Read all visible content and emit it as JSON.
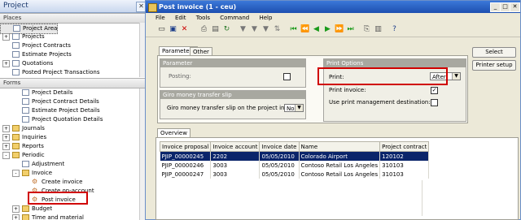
{
  "project_pane": {
    "title": "Project",
    "places_header": "Places",
    "places": [
      {
        "label": "Project Area",
        "icon": "project-area-icon",
        "selected": true,
        "expander": ""
      },
      {
        "label": "Projects",
        "icon": "grid-icon",
        "expander": "+"
      },
      {
        "label": "Project Contracts",
        "icon": "grid-icon",
        "expander": ""
      },
      {
        "label": "Estimate Projects",
        "icon": "grid-icon",
        "expander": ""
      },
      {
        "label": "Quotations",
        "icon": "grid-icon",
        "expander": "+"
      },
      {
        "label": "Posted Project Transactions",
        "icon": "grid-icon",
        "expander": ""
      }
    ],
    "forms_header": "Forms",
    "forms": [
      {
        "label": "Project Details",
        "icon": "form-icon",
        "expander": "",
        "indent": 1
      },
      {
        "label": "Project Contract Details",
        "icon": "form-icon",
        "expander": "",
        "indent": 1
      },
      {
        "label": "Estimate Project Details",
        "icon": "form-icon",
        "expander": "",
        "indent": 1
      },
      {
        "label": "Project Quotation Details",
        "icon": "form-icon",
        "expander": "",
        "indent": 1
      },
      {
        "label": "Journals",
        "icon": "folder-icon",
        "expander": "+",
        "indent": 0
      },
      {
        "label": "Inquiries",
        "icon": "folder-icon",
        "expander": "+",
        "indent": 0
      },
      {
        "label": "Reports",
        "icon": "folder-icon",
        "expander": "+",
        "indent": 0
      },
      {
        "label": "Periodic",
        "icon": "folder-icon",
        "expander": "-",
        "indent": 0
      },
      {
        "label": "Adjustment",
        "icon": "form-icon",
        "expander": "",
        "indent": 1
      },
      {
        "label": "Invoice",
        "icon": "folder-icon",
        "expander": "-",
        "indent": 1
      },
      {
        "label": "Create invoice",
        "icon": "gear-icon",
        "expander": "",
        "indent": 2
      },
      {
        "label": "Create on-account",
        "icon": "gear-icon",
        "expander": "",
        "indent": 2
      },
      {
        "label": "Post invoice",
        "icon": "gear-icon",
        "expander": "",
        "indent": 2,
        "highlighted": true
      },
      {
        "label": "Budget",
        "icon": "folder-icon",
        "expander": "+",
        "indent": 1
      },
      {
        "label": "Time and material",
        "icon": "folder-icon",
        "expander": "+",
        "indent": 1
      }
    ]
  },
  "window": {
    "title": "Post invoice (1 - ceu)",
    "menu": [
      "File",
      "Edit",
      "Tools",
      "Command",
      "Help"
    ],
    "tabs": [
      "Parameters",
      "Other"
    ],
    "parameter": {
      "header": "Parameter",
      "posting_label": "Posting:",
      "posting_checked": false
    },
    "giro": {
      "header": "Giro money transfer slip",
      "label": "Giro money transfer slip on the project invoice:",
      "value": "None"
    },
    "print_options": {
      "header": "Print Options",
      "print_label": "Print:",
      "print_value": "After",
      "print_invoice_label": "Print invoice:",
      "print_invoice_checked": true,
      "use_print_mgmt_label": "Use print management destination:",
      "use_print_mgmt_checked": false
    },
    "buttons": {
      "select": "Select",
      "printer_setup": "Printer setup"
    },
    "overview_tab": "Overview",
    "grid": {
      "columns": [
        "Invoice proposal",
        "Invoice account",
        "Invoice date",
        "Name",
        "Project contract"
      ],
      "rows": [
        [
          "PJIP_00000245",
          "2202",
          "05/05/2010",
          "Colorado Airport",
          "120102"
        ],
        [
          "PJIP_00000246",
          "3003",
          "05/05/2010",
          "Contoso Retail Los Angeles",
          "310103"
        ],
        [
          "PJIP_00000247",
          "3003",
          "05/05/2010",
          "Contoso Retail Los Angeles",
          "310103"
        ]
      ]
    }
  },
  "colors": {
    "highlight": "#d00000",
    "selection": "#0a246a",
    "title": "#1d4fb0"
  }
}
